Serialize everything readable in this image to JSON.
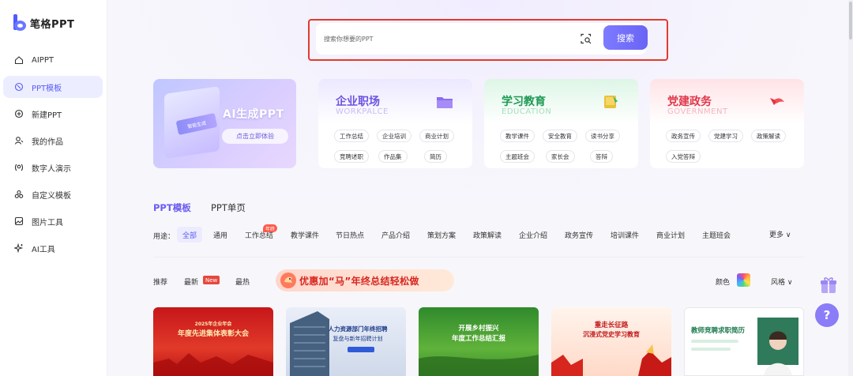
{
  "app": {
    "logo_text": "笔格PPT"
  },
  "sidebar": {
    "items": [
      {
        "label": "AIPPT",
        "icon": "home-icon"
      },
      {
        "label": "PPT模板",
        "icon": "template-icon",
        "active": true
      },
      {
        "label": "新建PPT",
        "icon": "plus-circle-icon"
      },
      {
        "label": "我的作品",
        "icon": "user-works-icon"
      },
      {
        "label": "数字人演示",
        "icon": "digital-human-icon"
      },
      {
        "label": "自定义模板",
        "icon": "custom-template-icon"
      },
      {
        "label": "图片工具",
        "icon": "image-tool-icon"
      },
      {
        "label": "AI工具",
        "icon": "sparkle-icon"
      }
    ]
  },
  "search": {
    "placeholder": "搜索你想要的PPT",
    "button_label": "搜索"
  },
  "ai_card": {
    "title": "AI生成PPT",
    "button_label": "点击立即体验",
    "deco_label": "智能生成"
  },
  "categories": [
    {
      "title": "企业职场",
      "subtitle": "WORKPALCE",
      "tags": [
        "工作总结",
        "企业培训",
        "商业计划",
        "竞聘述职",
        "作品集",
        "简历"
      ]
    },
    {
      "title": "学习教育",
      "subtitle": "EDUCATION",
      "tags": [
        "教学课件",
        "安全教育",
        "读书分享",
        "主题班会",
        "家长会",
        "答辩"
      ]
    },
    {
      "title": "党建政务",
      "subtitle": "GOVERNMENT",
      "tags": [
        "政务宣传",
        "党建学习",
        "政策解读",
        "入党答辩"
      ]
    }
  ],
  "tabs": {
    "active": "PPT模板",
    "inactive": "PPT单页"
  },
  "filters": {
    "label": "用途：",
    "items": [
      "全部",
      "通用",
      "工作总结",
      "教学课件",
      "节日热点",
      "产品介绍",
      "策划方案",
      "政策解读",
      "企业介绍",
      "政务宣传",
      "培训课件",
      "商业计划",
      "主题班会"
    ],
    "badge": "年终",
    "more": "更多 ∨"
  },
  "sort": {
    "items": [
      "推荐",
      "最新",
      "最热"
    ],
    "new_badge": "New",
    "promo_text": "优惠加“马”年终总结轻松做",
    "color_label": "颜色",
    "style_label": "风格 ∨"
  },
  "thumbnails": [
    {
      "line1": "2025年企业年会",
      "line2": "年度先进集体表彰大会"
    },
    {
      "line1": "人力资源部门年终招聘",
      "line2": "复盘与新年招聘计划"
    },
    {
      "line1": "开展乡村振兴",
      "line2": "年度工作总结汇报"
    },
    {
      "line1": "重走长征路",
      "line2": "沉浸式党史学习教育"
    },
    {
      "line1": "教师竞聘求职简历",
      "line2": ""
    }
  ],
  "help": {
    "label": "?"
  },
  "colors": {
    "accent": "#6a5cf2",
    "highlight_border": "#e23a2d"
  }
}
